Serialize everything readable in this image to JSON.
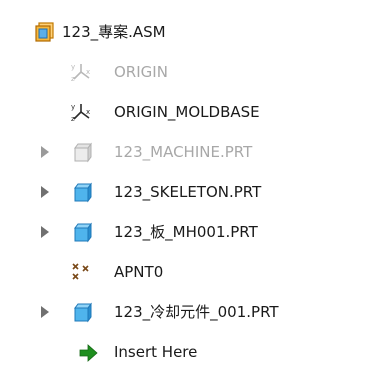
{
  "tree": {
    "items": [
      {
        "label": "123_專案.ASM",
        "icon": "assembly-icon",
        "state": "normal"
      },
      {
        "label": "ORIGIN",
        "icon": "coordinate-system-icon",
        "state": "dimmed"
      },
      {
        "label": "ORIGIN_MOLDBASE",
        "icon": "coordinate-system-icon",
        "state": "normal"
      },
      {
        "label": "123_MACHINE.PRT",
        "icon": "part-icon",
        "state": "dimmed",
        "expandable": true
      },
      {
        "label": "123_SKELETON.PRT",
        "icon": "part-icon",
        "state": "normal",
        "expandable": true
      },
      {
        "label": "123_板_MH001.PRT",
        "icon": "part-icon",
        "state": "normal",
        "expandable": true
      },
      {
        "label": "APNT0",
        "icon": "datum-points-icon",
        "state": "normal"
      },
      {
        "label": "123_冷却元件_001.PRT",
        "icon": "part-icon",
        "state": "normal",
        "expandable": true
      },
      {
        "label": "Insert Here",
        "icon": "insert-arrow-icon",
        "state": "normal"
      }
    ]
  },
  "colors": {
    "part_blue": "#3aa8e6",
    "assembly_orange": "#f0a020",
    "insert_green": "#1e8e1e",
    "dimmed_text": "#a8a8a8",
    "expander": "#707070"
  }
}
